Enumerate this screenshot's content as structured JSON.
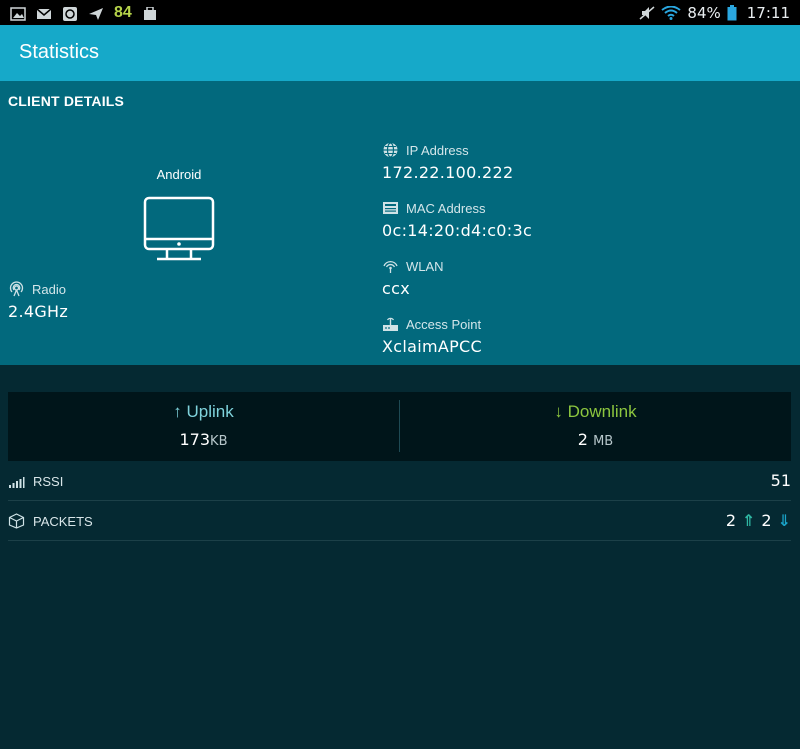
{
  "status_bar": {
    "notification_count": "84",
    "battery_percent": "84%",
    "time": "17:11",
    "icons": [
      "gallery-icon",
      "gmail-icon",
      "sync-app-icon",
      "send-icon",
      "bag-icon",
      "mute-icon",
      "wifi-icon",
      "battery-icon"
    ]
  },
  "app_bar": {
    "title": "Statistics"
  },
  "client": {
    "section_title": "CLIENT DETAILS",
    "device_name": "Android",
    "radio": {
      "label": "Radio",
      "value": "2.4GHz"
    },
    "ip": {
      "label": "IP Address",
      "value": "172.22.100.222"
    },
    "mac": {
      "label": "MAC Address",
      "value": "0c:14:20:d4:c0:3c"
    },
    "wlan": {
      "label": "WLAN",
      "value": "ccx"
    },
    "access_point": {
      "label": "Access Point",
      "value": "XclaimAPCC"
    }
  },
  "throughput": {
    "uplink": {
      "arrow": "↑",
      "label": "Uplink",
      "value": "173",
      "unit": "KB"
    },
    "downlink": {
      "arrow": "↓",
      "label": "Downlink",
      "value": "2",
      "unit": "MB"
    }
  },
  "rssi": {
    "label": "RSSI",
    "value": "51"
  },
  "packets": {
    "label": "PACKETS",
    "sent": "2",
    "received": "2",
    "up_arrow": "⇑",
    "down_arrow": "⇓"
  },
  "colors": {
    "app_bar": "#16a9c9",
    "panel": "#02697d",
    "background": "#052932",
    "uplink": "#7fd3dc",
    "downlink": "#8cc63f"
  }
}
